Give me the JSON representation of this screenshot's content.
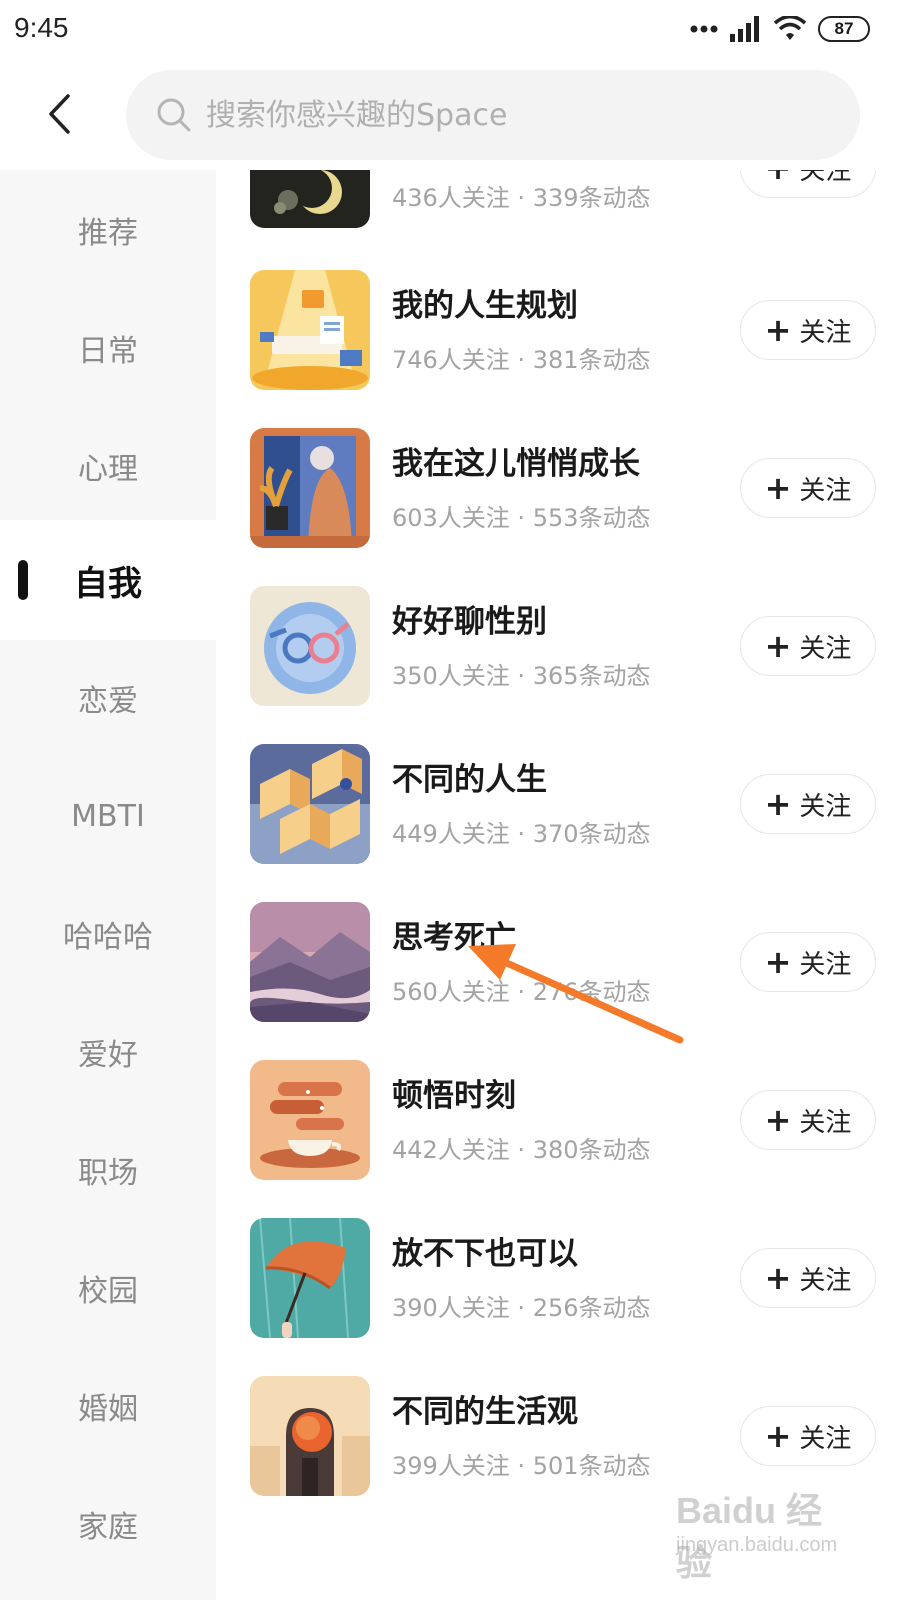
{
  "status_bar": {
    "time": "9:45",
    "battery": "87",
    "icons": [
      "dots-icon",
      "signal-icon",
      "wifi-icon",
      "battery-icon"
    ]
  },
  "search": {
    "placeholder": "搜索你感兴趣的Space",
    "value": ""
  },
  "sidebar": {
    "items": [
      {
        "label": "推荐"
      },
      {
        "label": "日常"
      },
      {
        "label": "心理"
      },
      {
        "label": "自我",
        "active": true
      },
      {
        "label": "恋爱"
      },
      {
        "label": "MBTI"
      },
      {
        "label": "哈哈哈"
      },
      {
        "label": "爱好"
      },
      {
        "label": "职场"
      },
      {
        "label": "校园"
      },
      {
        "label": "婚姻"
      },
      {
        "label": "家庭"
      }
    ]
  },
  "list": {
    "follow_label": "关注",
    "items": [
      {
        "title": "",
        "stats": "436人关注 · 339条动态"
      },
      {
        "title": "我的人生规划",
        "stats": "746人关注 · 381条动态"
      },
      {
        "title": "我在这儿悄悄成长",
        "stats": "603人关注 · 553条动态"
      },
      {
        "title": "好好聊性别",
        "stats": "350人关注 · 365条动态"
      },
      {
        "title": "不同的人生",
        "stats": "449人关注 · 370条动态"
      },
      {
        "title": "思考死亡",
        "stats": "560人关注 · 276条动态"
      },
      {
        "title": "顿悟时刻",
        "stats": "442人关注 · 380条动态"
      },
      {
        "title": "放不下也可以",
        "stats": "390人关注 · 256条动态"
      },
      {
        "title": "不同的生活观",
        "stats": "399人关注 · 501条动态"
      }
    ]
  },
  "watermark": {
    "brand": "Baidu 经验",
    "url": "jingyan.baidu.com"
  },
  "colors": {
    "annotation_arrow": "#f47a2a",
    "active_indicator": "#111111",
    "sidebar_bg": "#f7f7f7"
  }
}
